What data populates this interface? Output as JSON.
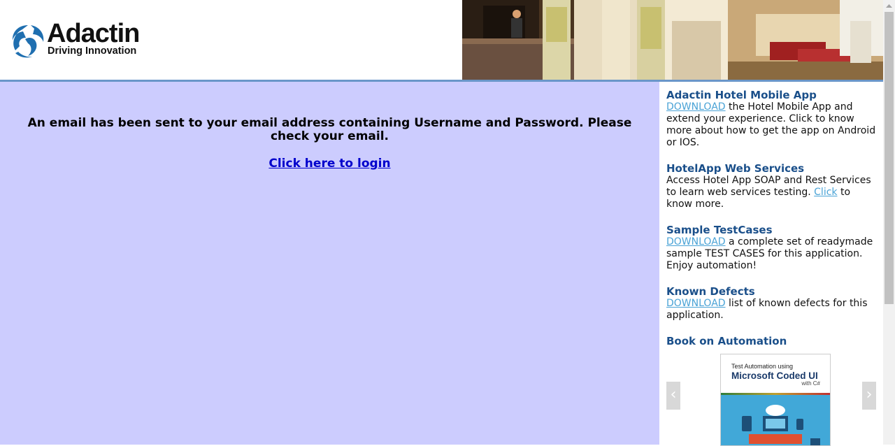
{
  "header": {
    "logo_title": "Adactin",
    "logo_tagline": "Driving Innovation"
  },
  "main": {
    "message": "An email has been sent to your email address containing Username and Password. Please check your email.",
    "login_link": "Click here to login"
  },
  "sidebar": {
    "sections": [
      {
        "title": "Adactin Hotel Mobile App",
        "link": "DOWNLOAD",
        "text": " the Hotel Mobile App and extend your experience. Click to know more about how to get the app on Android or IOS."
      },
      {
        "title": "HotelApp Web Services",
        "text_before": "Access Hotel App SOAP and Rest Services to learn web services testing. ",
        "link": "Click",
        "text_after": " to know more."
      },
      {
        "title": "Sample TestCases",
        "link": "DOWNLOAD",
        "text": " a complete set of readymade sample TEST CASES for this application. Enjoy automation!"
      },
      {
        "title": "Known Defects",
        "link": "DOWNLOAD",
        "text": " list of known defects for this application."
      },
      {
        "title": "Book on Automation"
      }
    ],
    "book": {
      "subtitle": "Test Automation using",
      "title": "Microsoft Coded UI",
      "with": "with C#"
    }
  },
  "colors": {
    "main_bg": "#ccccfe",
    "header_rule": "#6a96c9",
    "sidebar_heading": "#1a4f8a",
    "sidebar_link": "#4aa3d6",
    "login_link": "#0000cc"
  },
  "icons": {
    "carousel_prev": "chevron-left-icon",
    "carousel_next": "chevron-right-icon"
  }
}
